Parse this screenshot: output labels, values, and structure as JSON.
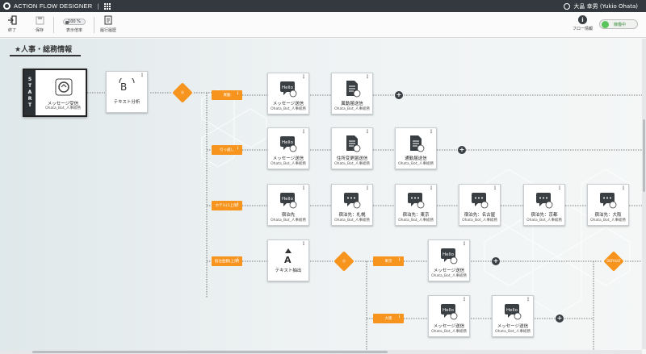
{
  "titlebar": {
    "app_title": "ACTION FLOW DESIGNER",
    "separator": "|",
    "user_name": "大畠 幸男 (Yukio Ohata)"
  },
  "toolbar": {
    "exit_label": "終了",
    "save_label": "保存",
    "zoom_value": "100 %",
    "zoom_label": "表示倍率",
    "history_label": "履行履歴",
    "flow_info_label": "フロー情報",
    "status_label": "稼働中"
  },
  "section": {
    "title": "★人事・総務情報"
  },
  "start": {
    "band": [
      "S",
      "T",
      "A",
      "R",
      "T"
    ],
    "title": "メッセージ受信",
    "subtitle": "Ohata_Bot_人事総務"
  },
  "nodes": {
    "text_analysis": {
      "title": "テキスト分析",
      "subtitle": ""
    },
    "row1_msg": {
      "title": "メッセージ送信",
      "subtitle": "Ohata_Bot_人事総務"
    },
    "row1_doc": {
      "title": "異動届送信",
      "subtitle": "Ohata_Bot_人事総務"
    },
    "row2_msg": {
      "title": "メッセージ送信",
      "subtitle": "Ohata_Bot_人事総務"
    },
    "row2_doc1": {
      "title": "住所変更届送信",
      "subtitle": "Ohata_Bot_人事総務"
    },
    "row2_doc2": {
      "title": "通勤届送信",
      "subtitle": "Ohata_Bot_人事総務"
    },
    "row3_msg": {
      "title": "宿泊先",
      "subtitle": "Ohata_Bot_人事総務"
    },
    "row3_sapporo": {
      "title": "宿泊先：札幌",
      "subtitle": "Ohata_Bot_人事総務"
    },
    "row3_tokyo": {
      "title": "宿泊先：東京",
      "subtitle": "Ohata_Bot_人事総務"
    },
    "row3_nagoya": {
      "title": "宿泊先：名古屋",
      "subtitle": "Ohata_Bot_人事総務"
    },
    "row3_kyoto": {
      "title": "宿泊先：京都",
      "subtitle": "Ohata_Bot_人事総務"
    },
    "row3_osaka": {
      "title": "宿泊先：大阪",
      "subtitle": "Ohata_Bot_人事総務"
    },
    "row4_extract": {
      "title": "テキスト抽出",
      "subtitle": ""
    },
    "row4_msg": {
      "title": "メッセージ送信",
      "subtitle": "Ohata_Bot_人事総務"
    },
    "row5_msg1": {
      "title": "メッセージ送信",
      "subtitle": "Ohata_Bot_人事総務"
    },
    "row5_msg2": {
      "title": "メッセージ送信",
      "subtitle": "Ohata_Bot_人事総務"
    }
  },
  "branches": {
    "row1": "異動",
    "row2": "引っ越し",
    "row3": "ホテル(1上限)",
    "row4": "宿泊金額(上限)",
    "row4a": "東京",
    "row5": "大阪"
  },
  "diamonds": {
    "d1": "分",
    "d2": "分",
    "d3": "DEFAULT"
  },
  "icons": {
    "hello_text": "Hello",
    "plus": "+",
    "menu": "⋮"
  },
  "colors": {
    "accent_orange": "#f7941d",
    "dark": "#2b3035",
    "status_green": "#5cc45c"
  }
}
